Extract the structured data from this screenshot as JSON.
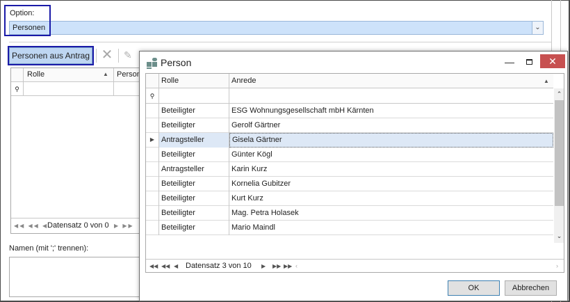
{
  "option": {
    "label": "Option:",
    "value": "Personen"
  },
  "toolbar": {
    "personen_button": "Personen aus Antrag"
  },
  "background_grid": {
    "col_rolle": "Rolle",
    "col_person": "Person",
    "nav_text": "Datensatz 0 von 0"
  },
  "names": {
    "label": "Namen (mit ';' trennen):"
  },
  "dialog": {
    "title": "Person",
    "columns": {
      "rolle": "Rolle",
      "anrede": "Anrede"
    },
    "rows": [
      {
        "rolle": "Beteiligter",
        "anrede": "ESG Wohnungsgesellschaft mbH Kärnten"
      },
      {
        "rolle": "Beteiligter",
        "anrede": "Gerolf Gärtner"
      },
      {
        "rolle": "Antragsteller",
        "anrede": "Gisela Gärtner",
        "selected": true
      },
      {
        "rolle": "Beteiligter",
        "anrede": "Günter Kögl"
      },
      {
        "rolle": "Antragsteller",
        "anrede": "Karin Kurz"
      },
      {
        "rolle": "Beteiligter",
        "anrede": "Kornelia Gubitzer"
      },
      {
        "rolle": "Beteiligter",
        "anrede": "Kurt Kurz"
      },
      {
        "rolle": "Beteiligter",
        "anrede": "Mag. Petra Holasek"
      },
      {
        "rolle": "Beteiligter",
        "anrede": "Mario Maindl"
      }
    ],
    "nav_text": "Datensatz 3 von 10",
    "ok_label": "OK",
    "cancel_label": "Abbrechen"
  },
  "icons": {
    "app_icon_color": "#6b8e8a",
    "close_color": "#c75050",
    "selection_color": "#dde8f6"
  }
}
